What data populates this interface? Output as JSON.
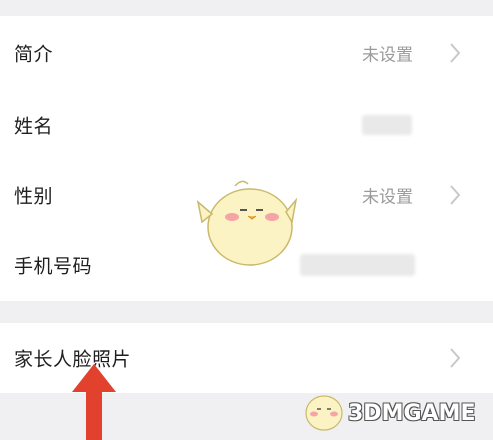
{
  "profile": {
    "rows": [
      {
        "label": "简介",
        "value": "未设置"
      },
      {
        "label": "姓名",
        "value": ""
      },
      {
        "label": "性别",
        "value": "未设置"
      },
      {
        "label": "手机号码",
        "value": ""
      }
    ],
    "parent_face": {
      "label": "家长人脸照片"
    }
  },
  "watermark": {
    "text": "3DMGAME"
  },
  "colors": {
    "background": "#f0f0f2",
    "card": "#ffffff",
    "label": "#1f1f1f",
    "value": "#9a9a9a",
    "chevron": "#c8c8c8",
    "arrow": "#e2412e"
  },
  "icons": {
    "chevron": "chevron-right-icon",
    "mascot": "yellow-chick-mascot",
    "arrow": "red-up-arrow"
  }
}
